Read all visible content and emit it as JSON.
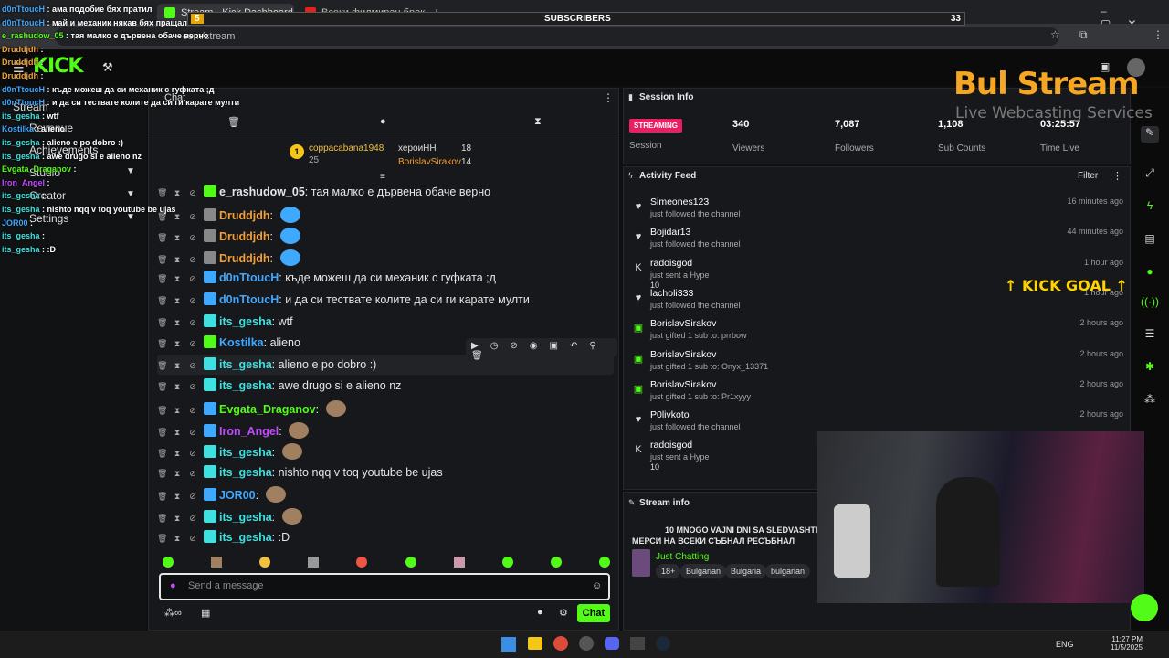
{
  "browser": {
    "tabs": [
      {
        "label": "Stream - Kick Dashboard",
        "active": true
      },
      {
        "label": "Всеки филмиран брокер 2 ч..."
      }
    ],
    "url": "com/stream"
  },
  "overlay": {
    "subscribers_label": "SUBSCRIBERS",
    "subscribers_count": "33",
    "subscribers_left": "5",
    "logo_main": "Bul Stream",
    "logo_sub": "Live Webcasting Services",
    "kick_goal": "KICK GOAL",
    "chat_lines": [
      {
        "user": "d0nTtoucH",
        "text": "ама подобие бях пратил"
      },
      {
        "user": "d0nTtoucH",
        "text": "май и механик някав бях пращал"
      },
      {
        "user": "e_rashudow_05",
        "text": "тая малко е дървена обаче верно"
      },
      {
        "user": "Druddjdh",
        "text": ""
      },
      {
        "user": "Druddjdh",
        "text": ""
      },
      {
        "user": "Druddjdh",
        "text": ""
      },
      {
        "user": "d0nTtoucH",
        "text": "къде можеш да си механик с гуфката ;д"
      },
      {
        "user": "d0nTtoucH",
        "text": "и да си тествате колите да си ги карате мулти"
      },
      {
        "user": "its_gesha",
        "text": "wtf"
      },
      {
        "user": "Kostilka",
        "text": "alieno"
      },
      {
        "user": "its_gesha",
        "text": "alieno e po dobro :)"
      },
      {
        "user": "its_gesha",
        "text": "awe drugo si e alieno nz"
      },
      {
        "user": "Evgata_Draganov",
        "text": ""
      },
      {
        "user": "Iron_Angel",
        "text": ""
      },
      {
        "user": "its_gesha",
        "text": ""
      },
      {
        "user": "its_gesha",
        "text": "nishto nqq v toq youtube be ujas"
      },
      {
        "user": "JOR00",
        "text": ""
      },
      {
        "user": "its_gesha",
        "text": ""
      },
      {
        "user": "its_gesha",
        "text": ":D"
      }
    ]
  },
  "sidebar": {
    "items": [
      "Stream",
      "Revenue",
      "Achievements",
      "Studio",
      "Creator",
      "Settings"
    ]
  },
  "chat": {
    "title": "Chat",
    "leaderboard": [
      {
        "name": "coppacabana1948",
        "count": "25"
      },
      {
        "name": "хероиНН",
        "count": "18"
      },
      {
        "name": "BorislavSirakov",
        "count": "14"
      }
    ],
    "messages": [
      {
        "user": "e_rashudow_05",
        "color": "#e6e6e6",
        "text": "тая малко е дървена обаче верно",
        "badge": "#53fc18"
      },
      {
        "user": "Druddjdh",
        "color": "#f0a13b",
        "text": "",
        "badge": "#888"
      },
      {
        "user": "Druddjdh",
        "color": "#f0a13b",
        "text": "",
        "badge": "#888"
      },
      {
        "user": "Druddjdh",
        "color": "#f0a13b",
        "text": "",
        "badge": "#888"
      },
      {
        "user": "d0nTtoucH",
        "color": "#3fa8ff",
        "text": "къде можеш да си механик с гуфката ;д",
        "badge": "#3fa8ff"
      },
      {
        "user": "d0nTtoucH",
        "color": "#3fa8ff",
        "text": "и да си тествате колите да си ги карате мулти",
        "badge": "#3fa8ff"
      },
      {
        "user": "its_gesha",
        "color": "#3fe0e0",
        "text": "wtf",
        "badge": "#3fe0e0"
      },
      {
        "user": "Kostilka",
        "color": "#3fa8ff",
        "text": "alieno",
        "badge": "#53fc18"
      },
      {
        "user": "its_gesha",
        "color": "#3fe0e0",
        "text": "alieno e po dobro :)",
        "badge": "#3fe0e0"
      },
      {
        "user": "its_gesha",
        "color": "#3fe0e0",
        "text": "awe drugo si e alieno nz",
        "badge": "#3fe0e0"
      },
      {
        "user": "Evgata_Draganov",
        "color": "#53fc18",
        "text": "",
        "badge": "#3fa8ff"
      },
      {
        "user": "Iron_Angel",
        "color": "#c04bff",
        "text": "",
        "badge": "#3fa8ff"
      },
      {
        "user": "its_gesha",
        "color": "#3fe0e0",
        "text": "",
        "badge": "#3fe0e0"
      },
      {
        "user": "its_gesha",
        "color": "#3fe0e0",
        "text": "nishto nqq v toq youtube be ujas",
        "badge": "#3fe0e0"
      },
      {
        "user": "JOR00",
        "color": "#3fa8ff",
        "text": "",
        "badge": "#3fa8ff"
      },
      {
        "user": "its_gesha",
        "color": "#3fe0e0",
        "text": "",
        "badge": "#3fe0e0"
      },
      {
        "user": "its_gesha",
        "color": "#3fe0e0",
        "text": ":D",
        "badge": "#3fe0e0"
      }
    ],
    "input_placeholder": "Send a message",
    "send_label": "Chat"
  },
  "session": {
    "title": "Session Info",
    "status": "STREAMING",
    "session_label": "Session",
    "stats": [
      {
        "value": "340",
        "label": "Viewers"
      },
      {
        "value": "7,087",
        "label": "Followers"
      },
      {
        "value": "1,108",
        "label": "Sub Counts"
      },
      {
        "value": "03:25:57",
        "label": "Time Live"
      }
    ]
  },
  "activity": {
    "title": "Activity Feed",
    "filter_label": "Filter",
    "events": [
      {
        "who": "Simeones123",
        "what": "just followed the channel",
        "when": "16 minutes ago",
        "icon": "heart-icon"
      },
      {
        "who": "Bojidar13",
        "what": "just followed the channel",
        "when": "44 minutes ago",
        "icon": "heart-icon"
      },
      {
        "who": "radoisgod",
        "what": "just sent a Hype",
        "extra": "10",
        "when": "1 hour ago",
        "icon": "kick-icon"
      },
      {
        "who": "lacholi333",
        "what": "just followed the channel",
        "when": "1 hour ago",
        "icon": "heart-icon"
      },
      {
        "who": "BorislavSirakov",
        "what": "just gifted 1 sub to: prrbow",
        "when": "2 hours ago",
        "icon": "gift-icon"
      },
      {
        "who": "BorislavSirakov",
        "what": "just gifted 1 sub to: Onyx_13371",
        "when": "2 hours ago",
        "icon": "gift-icon"
      },
      {
        "who": "BorislavSirakov",
        "what": "just gifted 1 sub to: Pr1xyyy",
        "when": "2 hours ago",
        "icon": "gift-icon"
      },
      {
        "who": "P0livkoto",
        "what": "just followed the channel",
        "when": "2 hours ago",
        "icon": "heart-icon"
      },
      {
        "who": "radoisgod",
        "what": "just sent a Hype",
        "extra": "10",
        "when": "2 hours ago",
        "icon": "kick-icon"
      }
    ]
  },
  "stream_info": {
    "title": "Stream info",
    "stream_title": "10 MNOGO VAJNI DNI SA SLEDVASHTITE",
    "stream_title2": "МЕРСИ НА ВСЕКИ СЪБНАЛ РЕСЪБНАЛ",
    "category": "Just Chatting",
    "tags": [
      "18+",
      "Bulgarian",
      "Bulgaria",
      "bulgarian"
    ]
  },
  "taskbar": {
    "lang": "ENG",
    "time": "11:27 PM",
    "date": "11/5/2025"
  },
  "colors": {
    "accent": "#53fc18",
    "streaming": "#e91e63",
    "logo": "#f5a623"
  }
}
